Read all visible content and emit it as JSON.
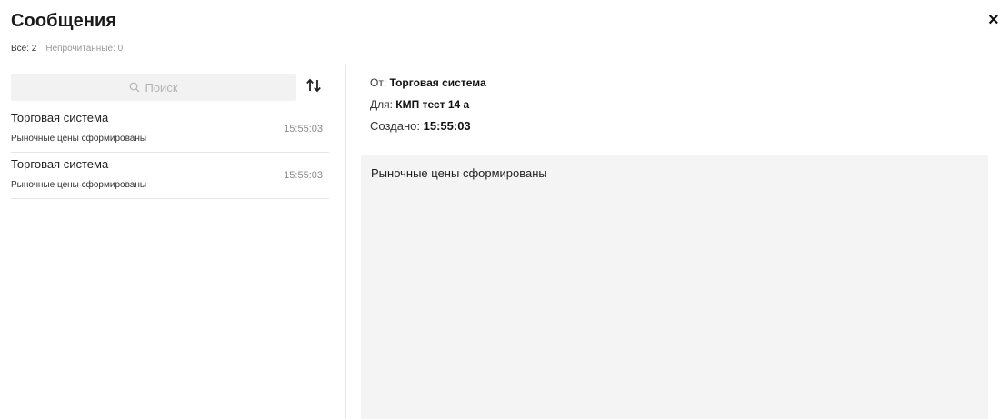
{
  "header": {
    "title": "Сообщения",
    "close_glyph": "×",
    "counter_all": "Все: 2",
    "counter_unread": "Непрочитанные: 0"
  },
  "search": {
    "placeholder": "Поиск",
    "icon": "search-icon",
    "sort_icon": "sort-arrows-icon"
  },
  "messages": [
    {
      "sender": "Торговая система",
      "preview": "Рыночные цены сформированы",
      "time": "15:55:03"
    },
    {
      "sender": "Торговая система",
      "preview": "Рыночные цены сформированы",
      "time": "15:55:03"
    }
  ],
  "detail": {
    "from_label": "От: ",
    "from_value": "Торговая система",
    "to_label": "Для: ",
    "to_value": "КМП тест 14 а",
    "created_label": "Создано: ",
    "created_value": "15:55:03",
    "body": "Рыночные цены сформированы"
  },
  "colors": {
    "divider": "#e6e6e6",
    "search_bg": "#f2f2f2",
    "body_bg": "#f4f4f4",
    "muted_text": "#999999"
  }
}
